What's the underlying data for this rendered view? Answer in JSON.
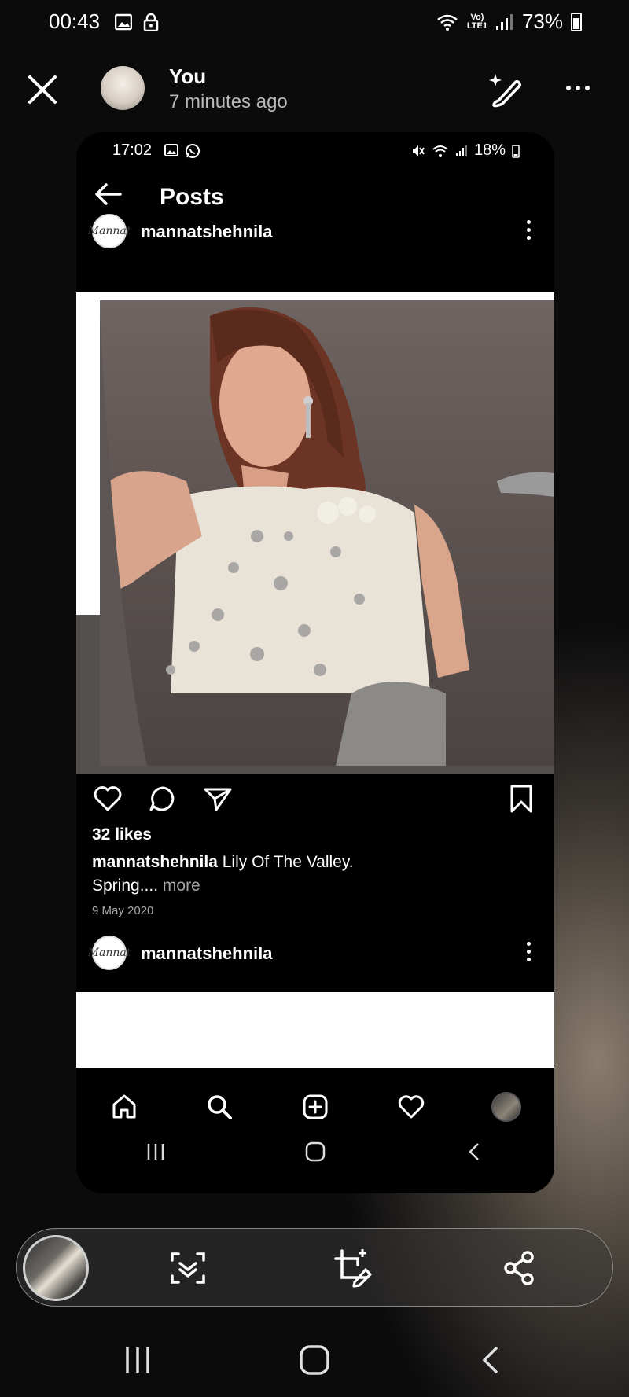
{
  "status_bar": {
    "time": "00:43",
    "battery": "73%"
  },
  "viewer": {
    "user_name": "You",
    "time_ago": "7 minutes ago"
  },
  "screenshot": {
    "status_bar": {
      "time": "17:02",
      "battery": "18%"
    },
    "header": {
      "title": "Posts"
    },
    "posts": [
      {
        "username": "mannatshehnila",
        "avatar_text": "Mannat",
        "likes": "32 likes",
        "caption_user": "mannatshehnila",
        "caption_text": "Lily Of The Valley.",
        "caption_line2": "Spring....",
        "more_label": "more",
        "date": "9 May 2020"
      },
      {
        "username": "mannatshehnila",
        "avatar_text": "Mannat"
      }
    ],
    "bottom_nav": [
      "home-icon",
      "search-icon",
      "add-post-icon",
      "heart-icon",
      "profile-avatar"
    ]
  },
  "toolbar": [
    "thumbnail",
    "scan-text-icon",
    "edit-crop-icon",
    "share-icon"
  ],
  "colors": {
    "background": "#0b0b0c",
    "phone_bg": "#000000",
    "muted_text": "#a8a8a8"
  }
}
